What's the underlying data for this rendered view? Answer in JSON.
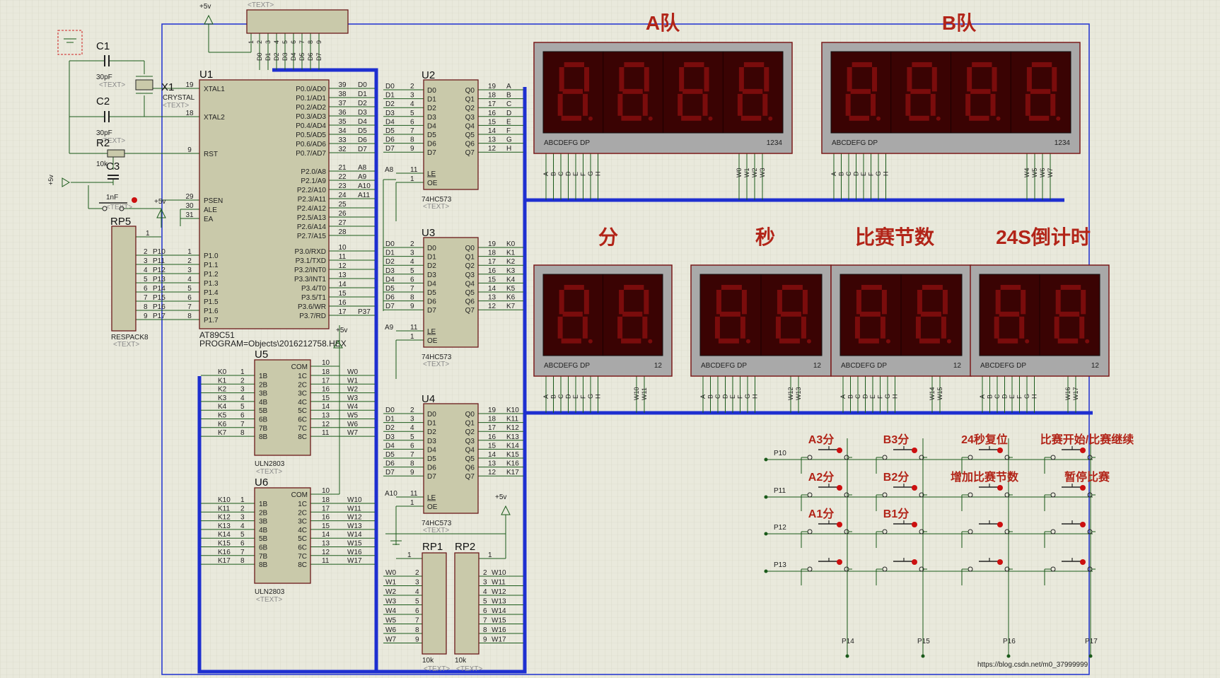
{
  "power": {
    "vcc": "+5v"
  },
  "header_tag": "<TEXT>",
  "top_header": {
    "pins": [
      "1",
      "2",
      "3",
      "4",
      "5",
      "6",
      "7",
      "8",
      "9"
    ],
    "nets": [
      "D0",
      "D1",
      "D2",
      "D3",
      "D4",
      "D5",
      "D6",
      "D7"
    ]
  },
  "osc": {
    "c1": "C1",
    "c1_val": "30pF",
    "c2": "C2",
    "c2_val": "30pF",
    "x1": "X1",
    "x1_val": "CRYSTAL",
    "r2": "R2",
    "r2_val": "10k",
    "c3": "C3",
    "c3_val": "1nF",
    "text_tag": "<TEXT>"
  },
  "u1": {
    "ref": "U1",
    "part": "AT89C51",
    "program": "PROGRAM=Objects\\2016212758.HEX",
    "left_pins": [
      {
        "num": "19",
        "name": "XTAL1"
      },
      {
        "num": "18",
        "name": "XTAL2"
      },
      {
        "num": "9",
        "name": "RST"
      },
      {
        "num": "29",
        "name": "PSEN"
      },
      {
        "num": "30",
        "name": "ALE"
      },
      {
        "num": "31",
        "name": "EA"
      },
      {
        "num": "1",
        "name": "P1.0"
      },
      {
        "num": "2",
        "name": "P1.1"
      },
      {
        "num": "3",
        "name": "P1.2"
      },
      {
        "num": "4",
        "name": "P1.3"
      },
      {
        "num": "5",
        "name": "P1.4"
      },
      {
        "num": "6",
        "name": "P1.5"
      },
      {
        "num": "7",
        "name": "P1.6"
      },
      {
        "num": "8",
        "name": "P1.7"
      }
    ],
    "right_pins": [
      {
        "num": "39",
        "name": "P0.0/AD0",
        "net": "D0"
      },
      {
        "num": "38",
        "name": "P0.1/AD1",
        "net": "D1"
      },
      {
        "num": "37",
        "name": "P0.2/AD2",
        "net": "D2"
      },
      {
        "num": "36",
        "name": "P0.3/AD3",
        "net": "D3"
      },
      {
        "num": "35",
        "name": "P0.4/AD4",
        "net": "D4"
      },
      {
        "num": "34",
        "name": "P0.5/AD5",
        "net": "D5"
      },
      {
        "num": "33",
        "name": "P0.6/AD6",
        "net": "D6"
      },
      {
        "num": "32",
        "name": "P0.7/AD7",
        "net": "D7"
      },
      {
        "num": "21",
        "name": "P2.0/A8",
        "net": "A8"
      },
      {
        "num": "22",
        "name": "P2.1/A9",
        "net": "A9"
      },
      {
        "num": "23",
        "name": "P2.2/A10",
        "net": "A10"
      },
      {
        "num": "24",
        "name": "P2.3/A11",
        "net": "A11"
      },
      {
        "num": "25",
        "name": "P2.4/A12",
        "net": ""
      },
      {
        "num": "26",
        "name": "P2.5/A13",
        "net": ""
      },
      {
        "num": "27",
        "name": "P2.6/A14",
        "net": ""
      },
      {
        "num": "28",
        "name": "P2.7/A15",
        "net": ""
      },
      {
        "num": "10",
        "name": "P3.0/RXD",
        "net": ""
      },
      {
        "num": "11",
        "name": "P3.1/TXD",
        "net": ""
      },
      {
        "num": "12",
        "name": "P3.2/INT0",
        "net": ""
      },
      {
        "num": "13",
        "name": "P3.3/INT1",
        "net": ""
      },
      {
        "num": "14",
        "name": "P3.4/T0",
        "net": ""
      },
      {
        "num": "15",
        "name": "P3.5/T1",
        "net": ""
      },
      {
        "num": "16",
        "name": "P3.6/WR",
        "net": ""
      },
      {
        "num": "17",
        "name": "P3.7/RD",
        "net": "P37"
      }
    ]
  },
  "rp5": {
    "ref": "RP5",
    "part": "RESPACK8",
    "tag": "<TEXT>",
    "nets": [
      "P10",
      "P11",
      "P12",
      "P13",
      "P14",
      "P15",
      "P16",
      "P17"
    ],
    "pins": [
      "2",
      "3",
      "4",
      "5",
      "6",
      "7",
      "8",
      "9"
    ]
  },
  "latch_pins": {
    "in_names": [
      "D0",
      "D1",
      "D2",
      "D3",
      "D4",
      "D5",
      "D6",
      "D7"
    ],
    "in_nums": [
      "2",
      "3",
      "4",
      "5",
      "6",
      "7",
      "8",
      "9"
    ],
    "out_names": [
      "Q0",
      "Q1",
      "Q2",
      "Q3",
      "Q4",
      "Q5",
      "Q6",
      "Q7"
    ],
    "out_nums": [
      "19",
      "18",
      "17",
      "16",
      "15",
      "14",
      "13",
      "12"
    ],
    "le": "LE",
    "oe": "OE",
    "le_num": "11",
    "oe_num": "1"
  },
  "u2": {
    "ref": "U2",
    "part": "74HC573",
    "le_net": "A8",
    "outs": [
      "A",
      "B",
      "C",
      "D",
      "E",
      "F",
      "G",
      "H"
    ]
  },
  "u3": {
    "ref": "U3",
    "part": "74HC573",
    "le_net": "A9",
    "outs": [
      "K0",
      "K1",
      "K2",
      "K3",
      "K4",
      "K5",
      "K6",
      "K7"
    ]
  },
  "u4": {
    "ref": "U4",
    "part": "74HC573",
    "le_net": "A10",
    "outs": [
      "K10",
      "K11",
      "K12",
      "K13",
      "K14",
      "K15",
      "K16",
      "K17"
    ]
  },
  "uln_pins": {
    "in_names": [
      "1B",
      "2B",
      "3B",
      "4B",
      "5B",
      "6B",
      "7B",
      "8B"
    ],
    "in_nums": [
      "1",
      "2",
      "3",
      "4",
      "5",
      "6",
      "7",
      "8"
    ],
    "out_names": [
      "1C",
      "2C",
      "3C",
      "4C",
      "5C",
      "6C",
      "7C",
      "8C"
    ],
    "out_nums": [
      "18",
      "17",
      "16",
      "15",
      "14",
      "13",
      "12",
      "11"
    ],
    "com": "COM",
    "com_num": "10"
  },
  "u5": {
    "ref": "U5",
    "part": "ULN2803",
    "ins": [
      "K0",
      "K1",
      "K2",
      "K3",
      "K4",
      "K5",
      "K6",
      "K7"
    ],
    "outs": [
      "W0",
      "W1",
      "W2",
      "W3",
      "W4",
      "W5",
      "W6",
      "W7"
    ]
  },
  "u6": {
    "ref": "U6",
    "part": "ULN2803",
    "ins": [
      "K10",
      "K11",
      "K12",
      "K13",
      "K14",
      "K15",
      "K16",
      "K17"
    ],
    "outs": [
      "W10",
      "W11",
      "W12",
      "W13",
      "W14",
      "W15",
      "W16",
      "W17"
    ]
  },
  "rp1": {
    "ref": "RP1",
    "val": "10k",
    "nets": [
      "W0",
      "W1",
      "W2",
      "W3",
      "W4",
      "W5",
      "W6",
      "W7"
    ]
  },
  "rp2": {
    "ref": "RP2",
    "val": "10k",
    "nets": [
      "W10",
      "W11",
      "W12",
      "W13",
      "W14",
      "W15",
      "W16",
      "W17"
    ]
  },
  "rp_pins": [
    "2",
    "3",
    "4",
    "5",
    "6",
    "7",
    "8",
    "9"
  ],
  "displays": {
    "seg_label": "ABCDEFG  DP",
    "team_a": {
      "title": "A队",
      "digits_label": "1234",
      "commons": [
        "W0",
        "W1",
        "W2",
        "W3"
      ]
    },
    "team_b": {
      "title": "B队",
      "digits_label": "1234",
      "commons": [
        "W4",
        "W5",
        "W6",
        "W7"
      ]
    },
    "minute": {
      "title": "分",
      "digits_label": "12",
      "commons": [
        "W10",
        "W11"
      ]
    },
    "second": {
      "title": "秒",
      "digits_label": "12",
      "commons": [
        "W12",
        "W13"
      ]
    },
    "period": {
      "title": "比赛节数",
      "digits_label": "12",
      "commons": [
        "W14",
        "W15"
      ]
    },
    "shot_clock": {
      "title": "24S倒计时",
      "digits_label": "12",
      "commons": [
        "W16",
        "W17"
      ]
    },
    "seg_pins": [
      "A",
      "B",
      "C",
      "D",
      "E",
      "F",
      "G",
      "H"
    ]
  },
  "keypad": {
    "rows": [
      "P10",
      "P11",
      "P12",
      "P13"
    ],
    "cols": [
      "P14",
      "P15",
      "P16",
      "P17"
    ],
    "labels": [
      [
        "A3分",
        "B3分",
        "24秒复位",
        "比赛开始/比赛继续"
      ],
      [
        "A2分",
        "B2分",
        "增加比赛节数",
        "暂停比赛"
      ],
      [
        "A1分",
        "B1分",
        "",
        ""
      ],
      [
        "",
        "",
        "",
        ""
      ]
    ]
  },
  "watermark": "https://blog.csdn.net/m0_37999999"
}
